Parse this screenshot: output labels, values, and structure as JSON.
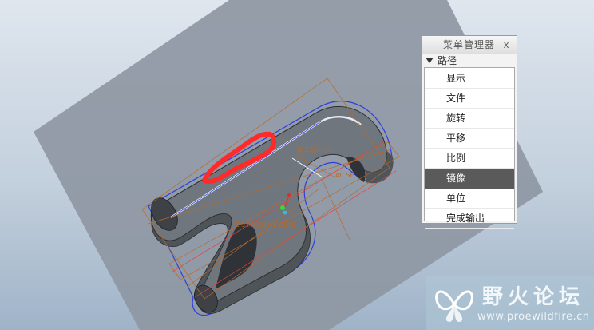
{
  "menu_manager": {
    "title": "菜单管理器",
    "close_glyph": "x",
    "section": "路径",
    "items": [
      {
        "label": "显示",
        "selected": false
      },
      {
        "label": "文件",
        "selected": false
      },
      {
        "label": "旋转",
        "selected": false
      },
      {
        "label": "平移",
        "selected": false
      },
      {
        "label": "比例",
        "selected": false
      },
      {
        "label": "镜像",
        "selected": true
      },
      {
        "label": "单位",
        "selected": false
      },
      {
        "label": "完成输出",
        "selected": false
      }
    ]
  },
  "viewport": {
    "datum_labels": [
      "加工轴CSYS",
      "AC SE",
      "Z 9 MACHINE CSYS"
    ]
  },
  "watermark": {
    "brand": "野火论坛",
    "url": "www.proewildfire.cn"
  },
  "colors": {
    "background_top": "#dfe6ee",
    "background_bottom": "#9fb3c8",
    "plane": "#8e97a3",
    "part": "#6c7279",
    "annotation_red": "#ff2a2a",
    "datum_orange": "#b86a2a",
    "menu_selected": "#5a5a5a"
  },
  "icons": {
    "section_toggle": "triangle-down-icon",
    "close": "close-icon",
    "logo": "butterfly-logo-icon"
  }
}
